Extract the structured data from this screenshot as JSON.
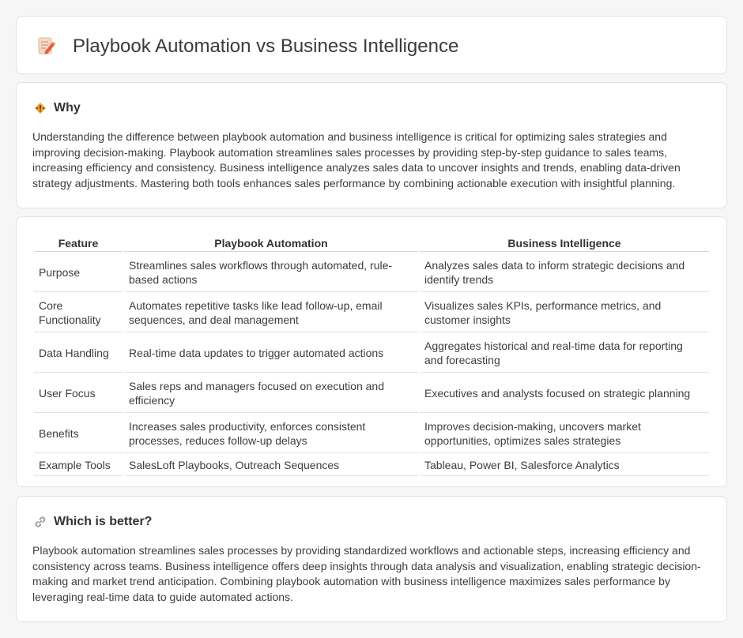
{
  "header": {
    "title": "Playbook Automation vs Business Intelligence",
    "icon": "document-pencil-icon"
  },
  "why": {
    "title": "Why",
    "icon": "warning-diamond-icon",
    "body": "Understanding the difference between playbook automation and business intelligence is critical for optimizing sales strategies and improving decision-making. Playbook automation streamlines sales processes by providing step-by-step guidance to sales teams, increasing efficiency and consistency. Business intelligence analyzes sales data to uncover insights and trends, enabling data-driven strategy adjustments. Mastering both tools enhances sales performance by combining actionable execution with insightful planning."
  },
  "comparison": {
    "headers": [
      "Feature",
      "Playbook Automation",
      "Business Intelligence"
    ],
    "rows": [
      [
        "Purpose",
        "Streamlines sales workflows through automated, rule-based actions",
        "Analyzes sales data to inform strategic decisions and identify trends"
      ],
      [
        "Core Functionality",
        "Automates repetitive tasks like lead follow-up, email sequences, and deal management",
        "Visualizes sales KPIs, performance metrics, and customer insights"
      ],
      [
        "Data Handling",
        "Real-time data updates to trigger automated actions",
        "Aggregates historical and real-time data for reporting and forecasting"
      ],
      [
        "User Focus",
        "Sales reps and managers focused on execution and efficiency",
        "Executives and analysts focused on strategic planning"
      ],
      [
        "Benefits",
        "Increases sales productivity, enforces consistent processes, reduces follow-up delays",
        "Improves decision-making, uncovers market opportunities, optimizes sales strategies"
      ],
      [
        "Example Tools",
        "SalesLoft Playbooks, Outreach Sequences",
        "Tableau, Power BI, Salesforce Analytics"
      ]
    ]
  },
  "better": {
    "title": "Which is better?",
    "icon": "link-icon",
    "body": "Playbook automation streamlines sales processes by providing standardized workflows and actionable steps, increasing efficiency and consistency across teams. Business intelligence offers deep insights through data analysis and visualization, enabling strategic decision-making and market trend anticipation. Combining playbook automation with business intelligence maximizes sales performance by leveraging real-time data to guide automated actions."
  },
  "colors": {
    "background": "#f6f6f6",
    "card": "#ffffff",
    "icon_orange": "#f0a030",
    "icon_red": "#e0533a"
  }
}
